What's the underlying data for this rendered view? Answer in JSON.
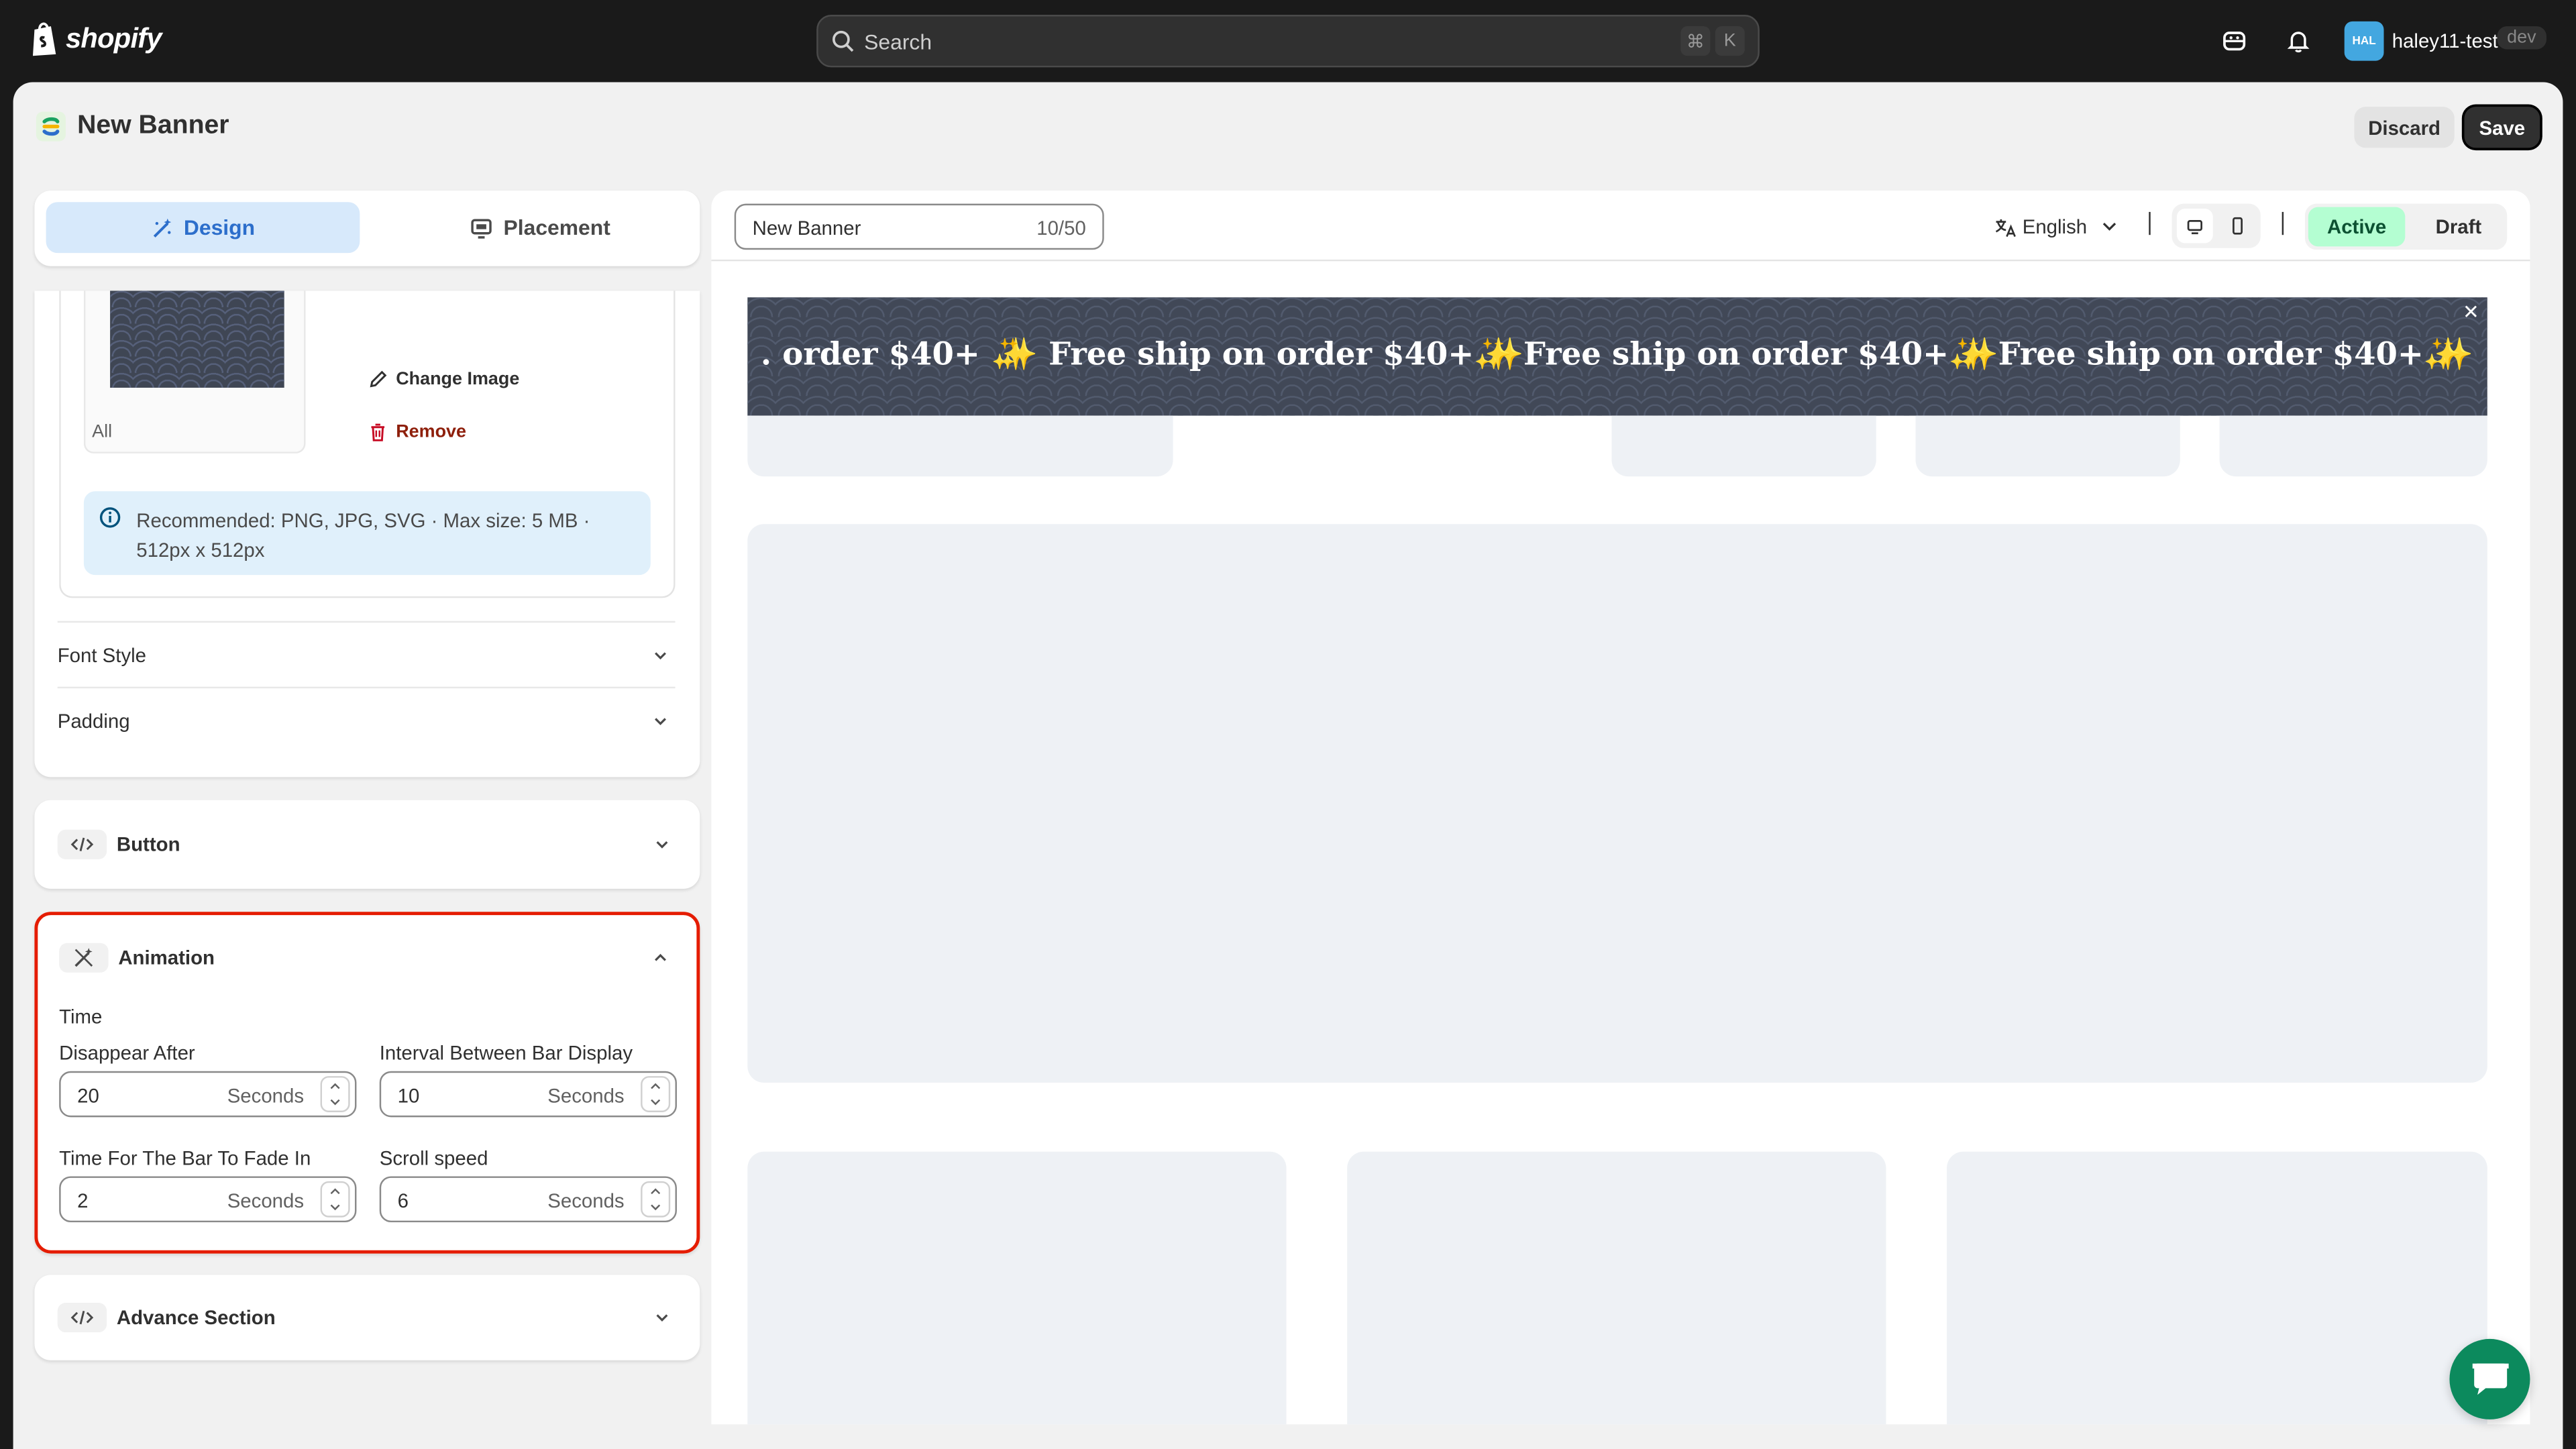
{
  "topbar": {
    "logo_text": "shopify",
    "search_placeholder": "Search",
    "shortcut_keys": [
      "⌘",
      "K"
    ],
    "avatar_initials": "HAL",
    "store_name": "haley11-test",
    "store_badge": "dev"
  },
  "header": {
    "title": "New Banner",
    "discard_label": "Discard",
    "save_label": "Save"
  },
  "tabs": [
    {
      "label": "Design",
      "active": true
    },
    {
      "label": "Placement",
      "active": false
    }
  ],
  "image_section": {
    "thumb_label": "All",
    "change_image_label": "Change Image",
    "remove_label": "Remove",
    "info_text": "Recommended: PNG, JPG, SVG · Max size: 5 MB · 512px x 512px"
  },
  "collapsibles": {
    "font_style": "Font Style",
    "padding": "Padding"
  },
  "button_section": {
    "title": "Button"
  },
  "animation_section": {
    "title": "Animation",
    "group_label": "Time",
    "fields": [
      {
        "label": "Disappear After",
        "value": "20",
        "unit": "Seconds"
      },
      {
        "label": "Interval Between Bar Display",
        "value": "10",
        "unit": "Seconds"
      },
      {
        "label": "Time For The Bar To Fade In",
        "value": "2",
        "unit": "Seconds"
      },
      {
        "label": "Scroll speed",
        "value": "6",
        "unit": "Seconds"
      }
    ]
  },
  "advance_section": {
    "title": "Advance Section"
  },
  "preview_toolbar": {
    "banner_name": "New Banner",
    "char_count": "10/50",
    "language": "English",
    "status_active": "Active",
    "status_draft": "Draft"
  },
  "banner": {
    "segments": [
      ". order $40+ ✨",
      "✨ Free ship on order $40+ ✨",
      "✨ Free ship on order $40+ ✨",
      "✨ Free ship on order $40+ ✨",
      "✨"
    ],
    "close_symbol": "✕"
  },
  "colors": {
    "accent_blue": "#2c6ecb",
    "active_green": "#b4fed2",
    "highlight_red": "#e51c00",
    "banner_bg": "#414857"
  },
  "icons": [
    "shopify-logo-icon",
    "search-icon",
    "cube-icon",
    "bell-icon",
    "magic-wand-icon",
    "monitor-icon",
    "edit-pencil-icon",
    "trash-icon",
    "info-icon",
    "chevron-down-icon",
    "chevron-up-icon",
    "code-icon",
    "translate-icon",
    "desktop-icon",
    "mobile-icon",
    "chat-icon"
  ]
}
